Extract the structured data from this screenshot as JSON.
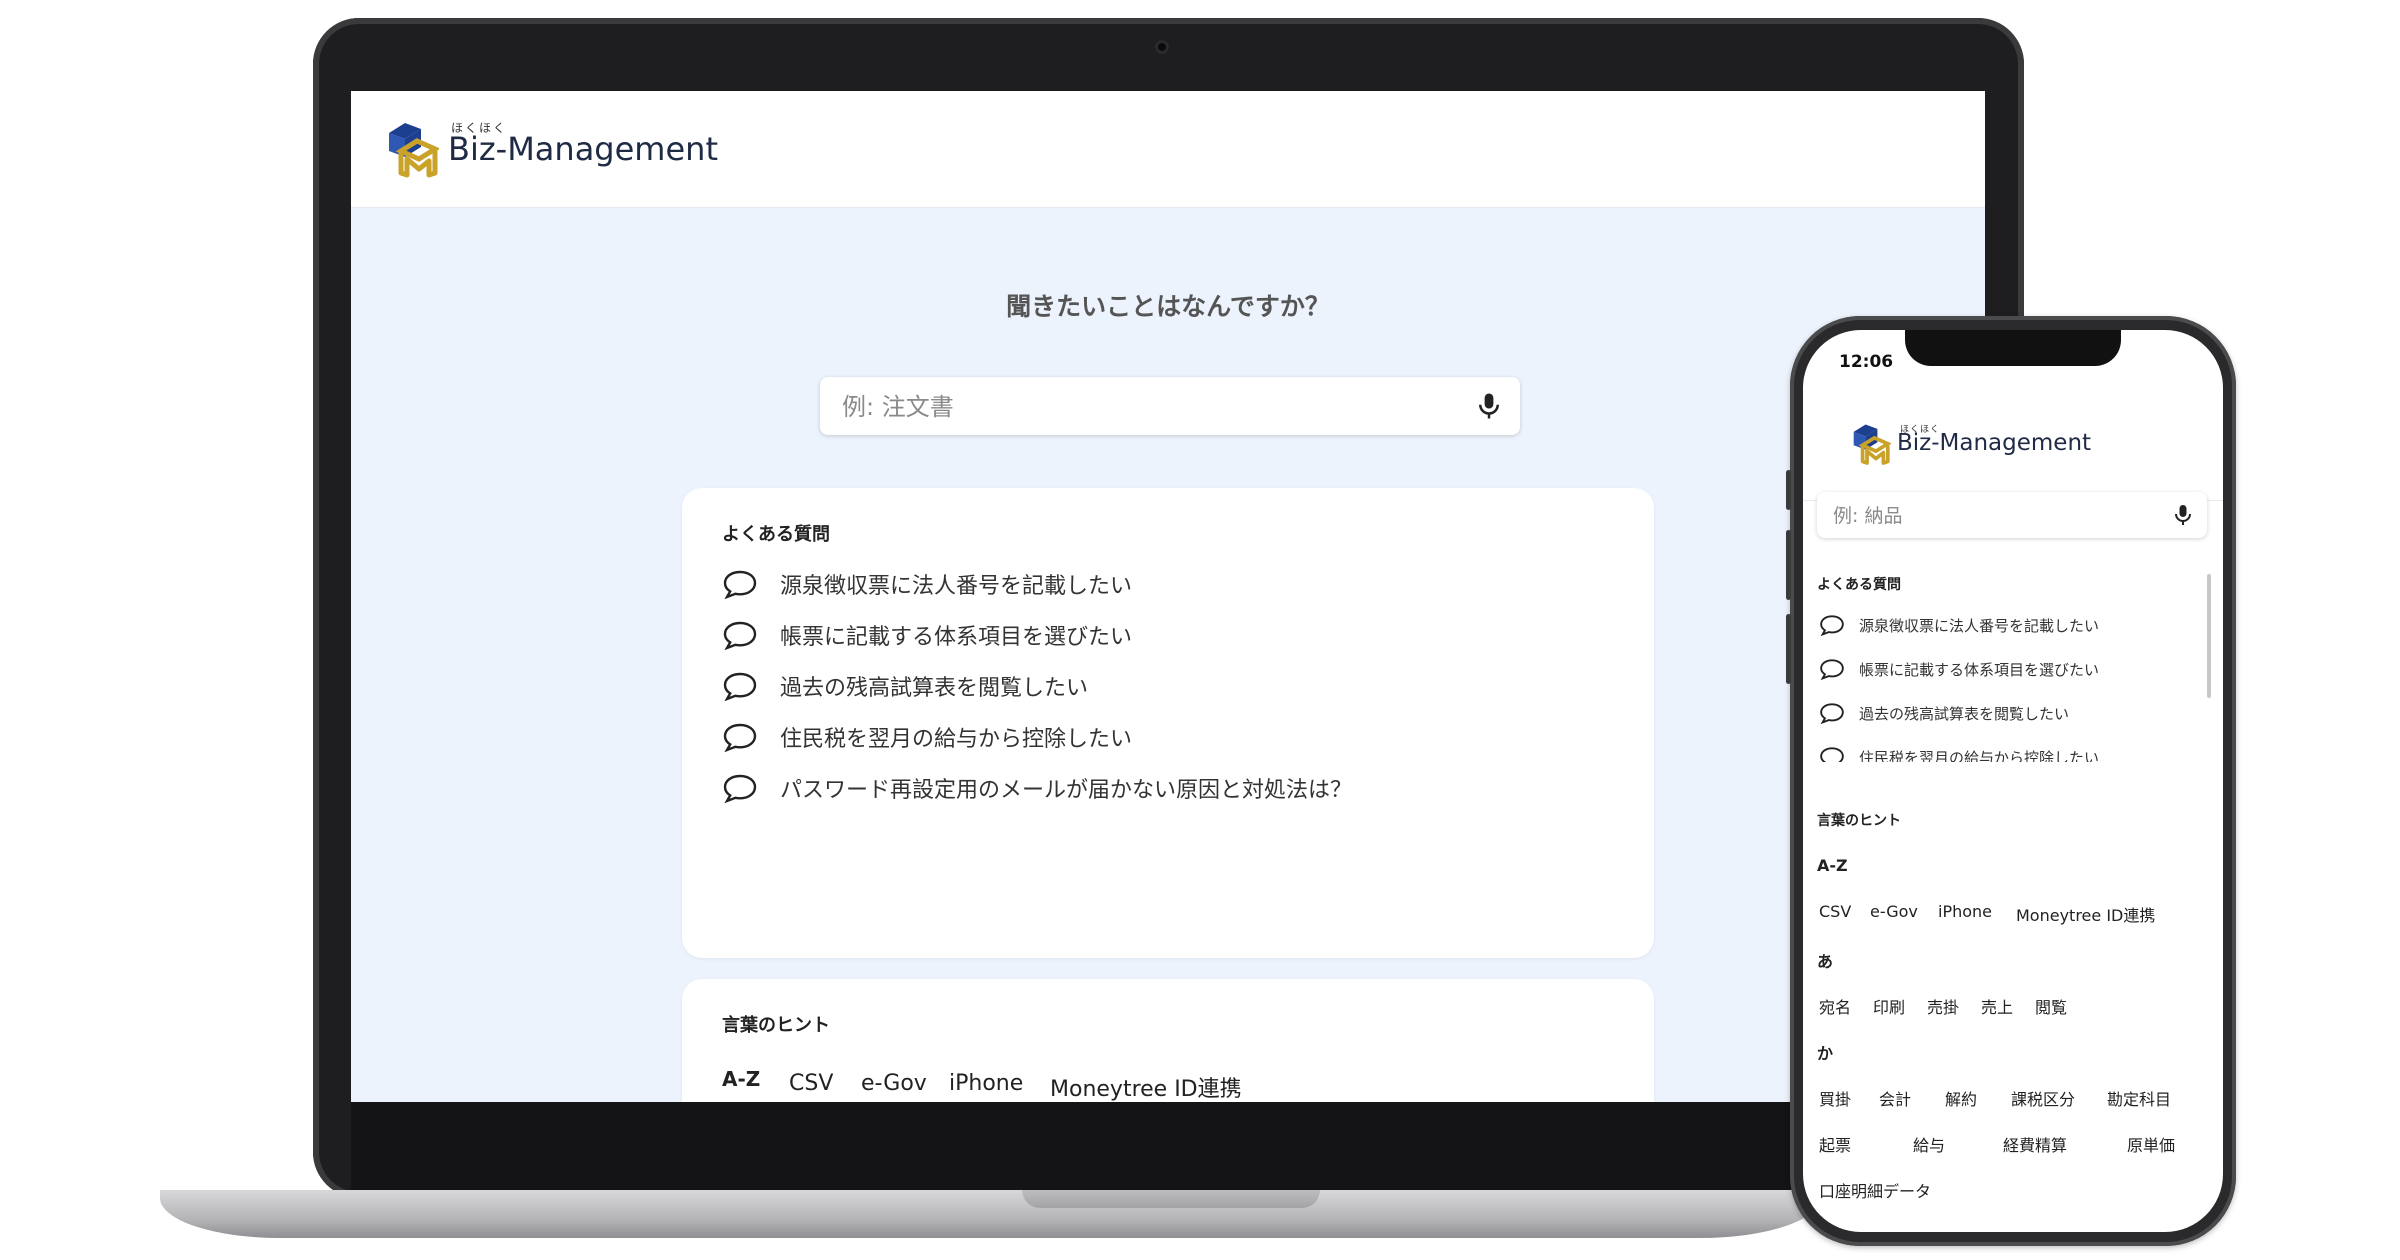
{
  "brand": {
    "kana": "ほくほく",
    "name": "Biz-Management"
  },
  "colors": {
    "accent_blue": "#1d3f8f",
    "accent_gold": "#c9a22a",
    "screen_bg": "#edf3fd"
  },
  "desktop": {
    "question": "聞きたいことはなんですか？",
    "search": {
      "placeholder": "例: 注文書",
      "mic_icon": "microphone-icon"
    },
    "faq": {
      "title": "よくある質問",
      "items": [
        "源泉徴収票に法人番号を記載したい",
        "帳票に記載する体系項目を選びたい",
        "過去の残高試算表を閲覧したい",
        "住民税を翌月の給与から控除したい",
        "パスワード再設定用のメールが届かない原因と対処法は？"
      ]
    },
    "hints": {
      "title": "言葉のヒント",
      "az_label": "A-Z",
      "az_words": [
        "CSV",
        "e-Gov",
        "iPhone",
        "Moneytree ID連携"
      ]
    }
  },
  "mobile": {
    "time": "12:06",
    "search": {
      "placeholder": "例: 納品"
    },
    "faq": {
      "title": "よくある質問",
      "items": [
        "源泉徴収票に法人番号を記載したい",
        "帳票に記載する体系項目を選びたい",
        "過去の残高試算表を閲覧したい",
        "住民税を翌月の給与から控除したい"
      ]
    },
    "hints": {
      "title": "言葉のヒント",
      "groups": [
        {
          "label": "A-Z",
          "words": [
            "CSV",
            "e-Gov",
            "iPhone",
            "Moneytree ID連携"
          ]
        },
        {
          "label": "あ",
          "words": [
            "宛名",
            "印刷",
            "売掛",
            "売上",
            "閲覧"
          ]
        },
        {
          "label": "か",
          "words": [
            "買掛",
            "会計",
            "解約",
            "課税区分",
            "勘定科目",
            "起票",
            "給与",
            "経費精算",
            "原単価",
            "口座明細データ"
          ]
        }
      ]
    }
  }
}
